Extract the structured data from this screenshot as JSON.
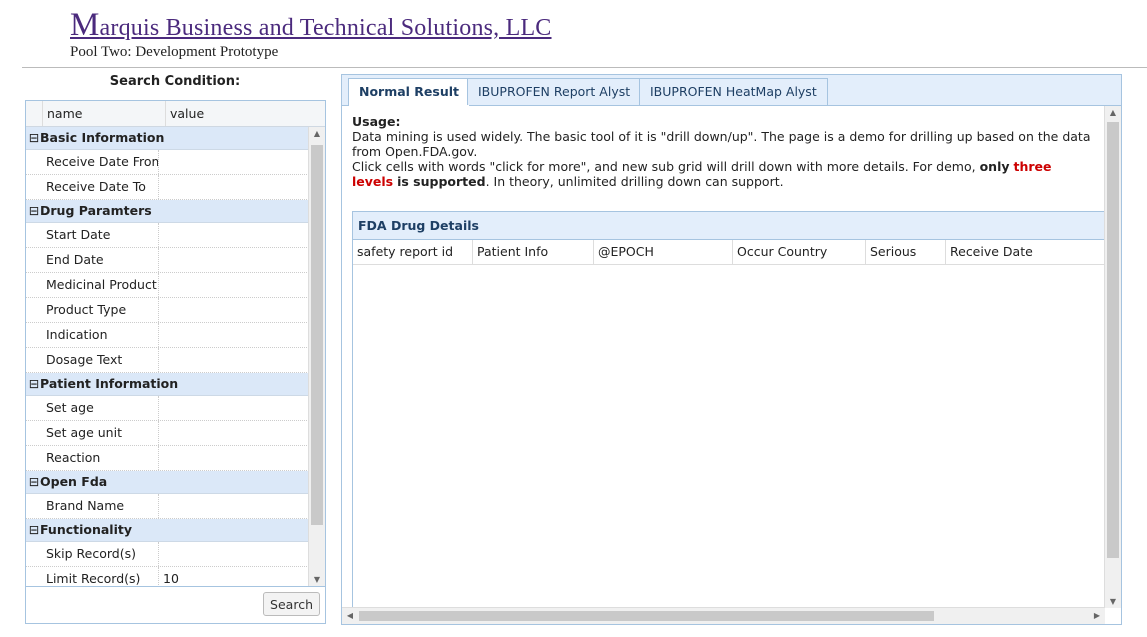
{
  "header": {
    "title_cap": "M",
    "title_rest": "arquis Business and Technical Solutions, LLC",
    "subtitle": "Pool Two: Development Prototype"
  },
  "left": {
    "search_condition": "Search Condition:",
    "col_name": "name",
    "col_value": "value",
    "groups": [
      {
        "label": "Basic Information",
        "props": [
          {
            "name": "Receive Date From",
            "value": ""
          },
          {
            "name": "Receive Date To",
            "value": ""
          }
        ]
      },
      {
        "label": "Drug Paramters",
        "props": [
          {
            "name": "Start Date",
            "value": ""
          },
          {
            "name": "End Date",
            "value": ""
          },
          {
            "name": "Medicinal Product",
            "value": ""
          },
          {
            "name": "Product Type",
            "value": ""
          },
          {
            "name": "Indication",
            "value": ""
          },
          {
            "name": "Dosage Text",
            "value": ""
          }
        ]
      },
      {
        "label": "Patient Information",
        "props": [
          {
            "name": "Set age",
            "value": ""
          },
          {
            "name": "Set age unit",
            "value": ""
          },
          {
            "name": "Reaction",
            "value": ""
          }
        ]
      },
      {
        "label": "Open Fda",
        "props": [
          {
            "name": "Brand Name",
            "value": ""
          }
        ]
      },
      {
        "label": "Functionality",
        "props": [
          {
            "name": "Skip Record(s)",
            "value": ""
          },
          {
            "name": "Limit Record(s)",
            "value": "10"
          }
        ]
      }
    ],
    "search_button": "Search"
  },
  "tabs": [
    "Normal Result",
    "IBUPROFEN Report Alyst",
    "IBUPROFEN HeatMap Alyst"
  ],
  "usage": {
    "heading": "Usage:",
    "line1": "Data mining is used widely. The basic tool of it is \"drill down/up\". The page is a demo for drilling up based on the data from Open.FDA.gov.",
    "line2_a": "Click cells with words \"click for more\", and new sub grid will drill down with more details. For demo, ",
    "line2_b": "only",
    "line2_c": "three levels",
    "line2_d": "is supported",
    "line2_e": ". In theory, unlimited drilling down can support."
  },
  "grid": {
    "caption": "FDA Drug Details",
    "columns": [
      "safety report id",
      "Patient Info",
      "@EPOCH",
      "Occur Country",
      "Serious",
      "Receive Date"
    ]
  }
}
